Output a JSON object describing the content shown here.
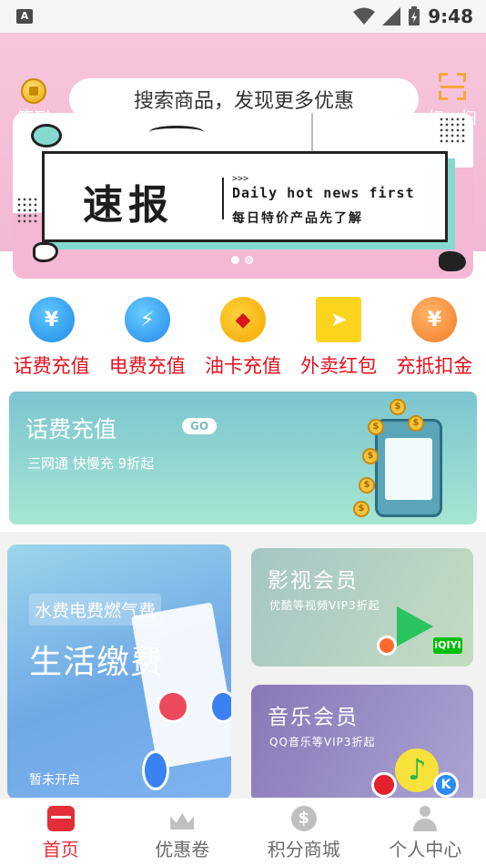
{
  "status": {
    "time": "9:48",
    "left_icon": "A"
  },
  "header": {
    "sign_label": "签到",
    "search_placeholder": "搜索商品，发现更多优惠",
    "scan_label": "扫一扫"
  },
  "banner": {
    "headline": "速报",
    "arrows": ">>>",
    "english": "Daily hot news first",
    "chinese": "每日特价产品先了解",
    "page_count": 2,
    "active_page": 1
  },
  "quick_icons": [
    {
      "label": "话费充值",
      "icon": "phone-recharge-icon",
      "glyph": "¥"
    },
    {
      "label": "电费充值",
      "icon": "electricity-icon",
      "glyph": "⚡"
    },
    {
      "label": "油卡充值",
      "icon": "oil-card-icon",
      "glyph": "◆"
    },
    {
      "label": "外卖红包",
      "icon": "takeout-icon",
      "glyph": "➤"
    },
    {
      "label": "充抵扣金",
      "icon": "deduction-icon",
      "glyph": "¥"
    }
  ],
  "recharge_card": {
    "title": "话费充值",
    "go": "GO",
    "subtitle": "三网通 快慢充 9折起",
    "coin_glyph": "$"
  },
  "life_card": {
    "tag": "水费电费燃气费",
    "title": "生活缴费",
    "status": "暂未开启"
  },
  "video_card": {
    "title": "影视会员",
    "subtitle": "优酷等视频VIP3折起",
    "iqiyi": "iQIYI"
  },
  "music_card": {
    "title": "音乐会员",
    "subtitle": "QQ音乐等VIP3折起",
    "note": "♪",
    "kugou": "K"
  },
  "tabs": [
    {
      "label": "首页",
      "icon": "home-icon",
      "active": true
    },
    {
      "label": "优惠卷",
      "icon": "crown-icon",
      "active": false
    },
    {
      "label": "积分商城",
      "icon": "dollar-icon",
      "glyph": "$",
      "active": false
    },
    {
      "label": "个人中心",
      "icon": "user-icon",
      "active": false
    }
  ],
  "colors": {
    "accent_red": "#e4111d",
    "header_pink": "#f2b9d4",
    "tab_active": "#e42e37"
  }
}
